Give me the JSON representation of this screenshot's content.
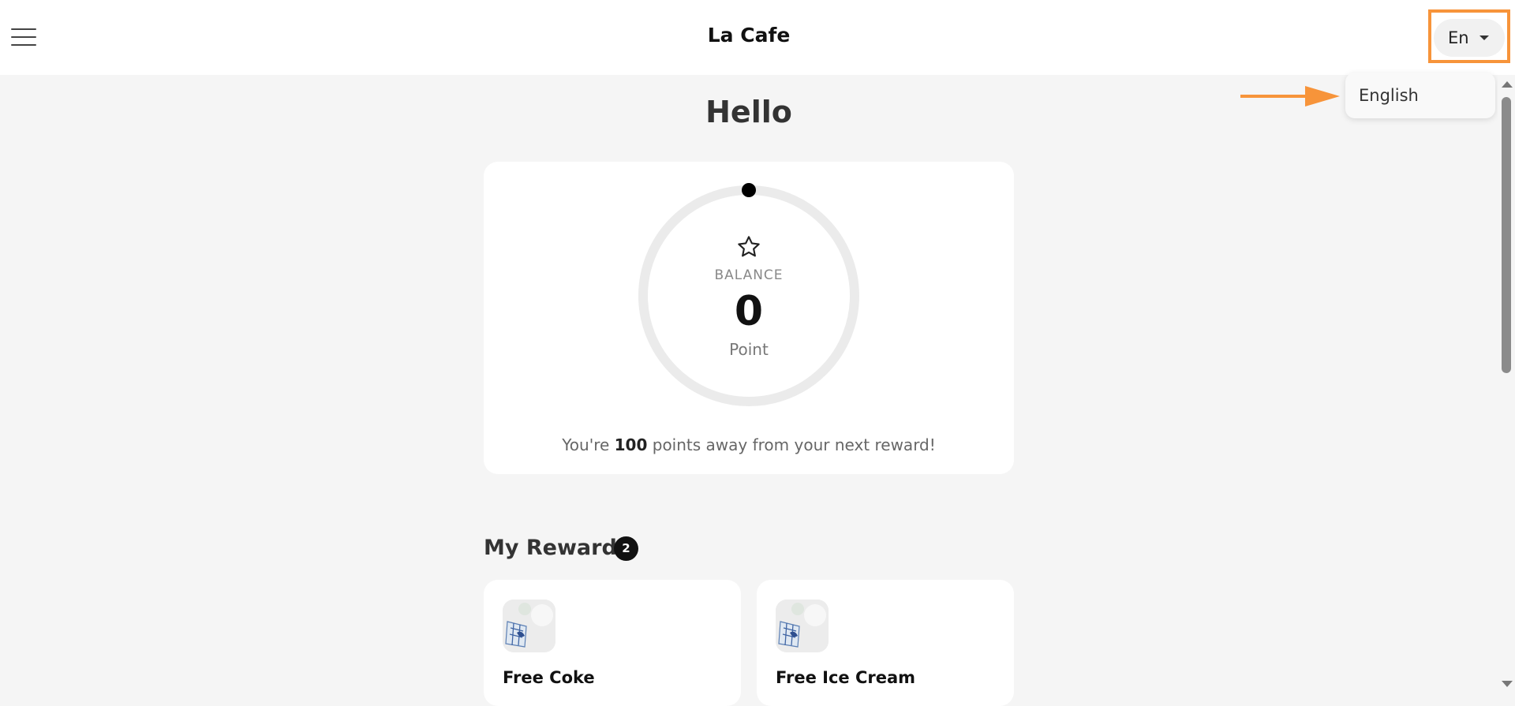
{
  "header": {
    "title": "La Cafe",
    "menu_icon": "hamburger-menu-icon"
  },
  "language": {
    "selected": "En",
    "options": [
      "English"
    ]
  },
  "home": {
    "greeting": "Hello"
  },
  "balance": {
    "label": "BALANCE",
    "value": "0",
    "unit": "Point",
    "progress": 0,
    "msg_prefix": "You're ",
    "points_away": "100",
    "msg_suffix": " points away from your next reward!"
  },
  "rewards": {
    "title": "My Rewards",
    "count": "2",
    "items": [
      {
        "name": "Free Coke"
      },
      {
        "name": "Free Ice Cream"
      }
    ]
  },
  "colors": {
    "highlight": "#f7943a",
    "background": "#f5f5f5",
    "card": "#ffffff",
    "ring_track": "#ebebeb"
  }
}
